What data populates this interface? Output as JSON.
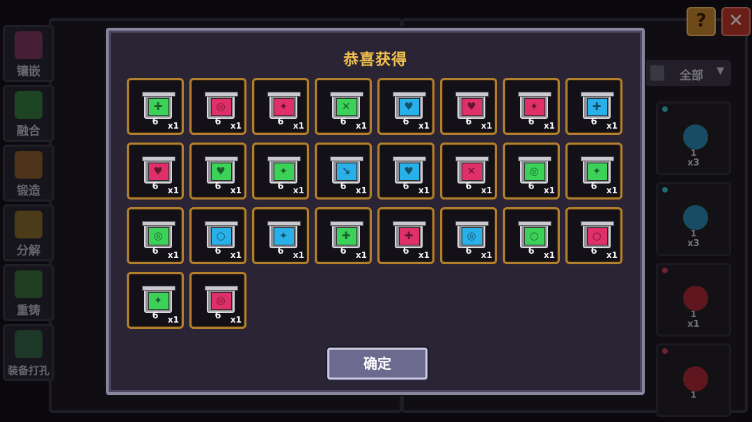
{
  "sidebar": {
    "items": [
      {
        "label": "镶嵌",
        "icon": "socket-icon",
        "color": "#c24b8a"
      },
      {
        "label": "融合",
        "icon": "fusion-icon",
        "color": "#3fc24b"
      },
      {
        "label": "锻造",
        "icon": "forge-icon",
        "color": "#d88a2a"
      },
      {
        "label": "分解",
        "icon": "decompose-icon",
        "color": "#d8a52a"
      },
      {
        "label": "重铸",
        "icon": "recast-icon",
        "color": "#4ab04a"
      },
      {
        "label": "装备打孔",
        "icon": "drill-icon",
        "color": "#3f9a5a"
      }
    ]
  },
  "top_buttons": {
    "help_label": "?",
    "close_label": "✕"
  },
  "filter": {
    "label": "全部",
    "icon": "helmet-icon",
    "chevron": "▼"
  },
  "right_cards": [
    {
      "level": "1",
      "count": "x3",
      "dot_color": "#35c4c8",
      "orb_color": "#2c8ab8"
    },
    {
      "level": "1",
      "count": "x3",
      "dot_color": "#35c4c8",
      "orb_color": "#2c8ab8"
    },
    {
      "level": "1",
      "count": "x1",
      "dot_color": "#d0405a",
      "orb_color": "#b0283a"
    },
    {
      "level": "1",
      "count": "",
      "dot_color": "#d0405a",
      "orb_color": "#b0283a"
    }
  ],
  "dialog": {
    "title": "恭喜获得",
    "confirm_label": "确定"
  },
  "rewards": [
    {
      "level": "6",
      "qty": "x1",
      "color": "#3cd25a",
      "symbol": "✚",
      "icon": "attack-gem-icon"
    },
    {
      "level": "6",
      "qty": "x1",
      "color": "#e0306a",
      "symbol": "◎",
      "icon": "spiral-gem-icon"
    },
    {
      "level": "6",
      "qty": "x1",
      "color": "#e0306a",
      "symbol": "✦",
      "icon": "wing-gem-icon"
    },
    {
      "level": "6",
      "qty": "x1",
      "color": "#3cd25a",
      "symbol": "✕",
      "icon": "cross-gem-icon"
    },
    {
      "level": "6",
      "qty": "x1",
      "color": "#2ab0e8",
      "symbol": "♥",
      "icon": "heart-gem-icon"
    },
    {
      "level": "6",
      "qty": "x1",
      "color": "#e0306a",
      "symbol": "♥",
      "icon": "heart-gem-icon"
    },
    {
      "level": "6",
      "qty": "x1",
      "color": "#e0306a",
      "symbol": "✦",
      "icon": "wing-gem-icon"
    },
    {
      "level": "6",
      "qty": "x1",
      "color": "#2ab0e8",
      "symbol": "✚",
      "icon": "plus-gem-icon"
    },
    {
      "level": "6",
      "qty": "x1",
      "color": "#e0306a",
      "symbol": "♥",
      "icon": "heart-gem-icon"
    },
    {
      "level": "6",
      "qty": "x1",
      "color": "#3cd25a",
      "symbol": "♥",
      "icon": "heart-gem-icon"
    },
    {
      "level": "6",
      "qty": "x1",
      "color": "#3cd25a",
      "symbol": "✦",
      "icon": "wing-gem-icon"
    },
    {
      "level": "6",
      "qty": "x1",
      "color": "#2ab0e8",
      "symbol": "↘",
      "icon": "arrow-gem-icon"
    },
    {
      "level": "6",
      "qty": "x1",
      "color": "#2ab0e8",
      "symbol": "♥",
      "icon": "heart-gem-icon"
    },
    {
      "level": "6",
      "qty": "x1",
      "color": "#e0306a",
      "symbol": "✕",
      "icon": "cross-gem-icon"
    },
    {
      "level": "6",
      "qty": "x1",
      "color": "#3cd25a",
      "symbol": "◎",
      "icon": "spiral-gem-icon"
    },
    {
      "level": "6",
      "qty": "x1",
      "color": "#3cd25a",
      "symbol": "✦",
      "icon": "wing-gem-icon"
    },
    {
      "level": "6",
      "qty": "x1",
      "color": "#3cd25a",
      "symbol": "◎",
      "icon": "spiral-gem-icon"
    },
    {
      "level": "6",
      "qty": "x1",
      "color": "#2ab0e8",
      "symbol": "○",
      "icon": "ring-gem-icon"
    },
    {
      "level": "6",
      "qty": "x1",
      "color": "#2ab0e8",
      "symbol": "✦",
      "icon": "wing-gem-icon"
    },
    {
      "level": "6",
      "qty": "x1",
      "color": "#3cd25a",
      "symbol": "✚",
      "icon": "plus-gem-icon"
    },
    {
      "level": "6",
      "qty": "x1",
      "color": "#e0306a",
      "symbol": "✚",
      "icon": "plus-gem-icon"
    },
    {
      "level": "6",
      "qty": "x1",
      "color": "#2ab0e8",
      "symbol": "◎",
      "icon": "spiral-gem-icon"
    },
    {
      "level": "6",
      "qty": "x1",
      "color": "#3cd25a",
      "symbol": "○",
      "icon": "ring-gem-icon"
    },
    {
      "level": "6",
      "qty": "x1",
      "color": "#e0306a",
      "symbol": "○",
      "icon": "ring-gem-icon"
    },
    {
      "level": "6",
      "qty": "x1",
      "color": "#3cd25a",
      "symbol": "✦",
      "icon": "wing-gem-icon"
    },
    {
      "level": "6",
      "qty": "x1",
      "color": "#e0306a",
      "symbol": "◎",
      "icon": "spiral-gem-icon"
    }
  ]
}
